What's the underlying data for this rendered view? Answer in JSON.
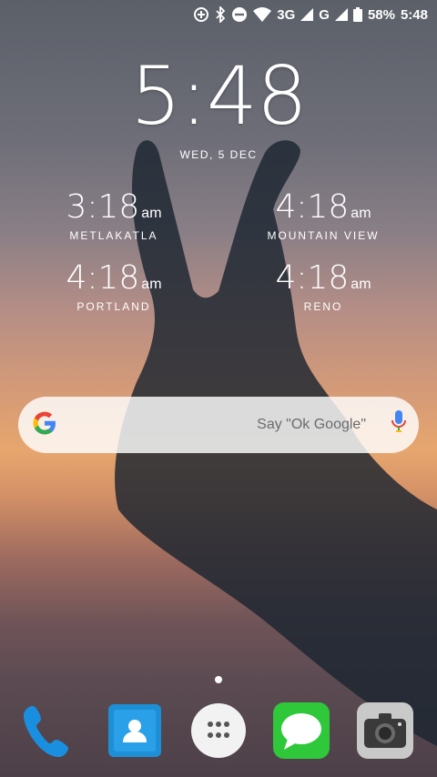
{
  "status_bar": {
    "network": "3G",
    "network2": "G",
    "battery": "58%",
    "time": "5:48"
  },
  "lock": {
    "time": "5:48",
    "date": "WED, 5 DEC"
  },
  "world_clocks": [
    {
      "time": "3:18",
      "ampm": "am",
      "city": "METLAKATLA"
    },
    {
      "time": "4:18",
      "ampm": "am",
      "city": "MOUNTAIN VIEW"
    },
    {
      "time": "4:18",
      "ampm": "am",
      "city": "PORTLAND"
    },
    {
      "time": "4:18",
      "ampm": "am",
      "city": "RENO"
    }
  ],
  "search": {
    "hint": "Say \"Ok Google\""
  },
  "dock": {
    "icons": [
      "phone-icon",
      "contacts-icon",
      "app-drawer-icon",
      "messages-icon",
      "camera-icon"
    ]
  }
}
